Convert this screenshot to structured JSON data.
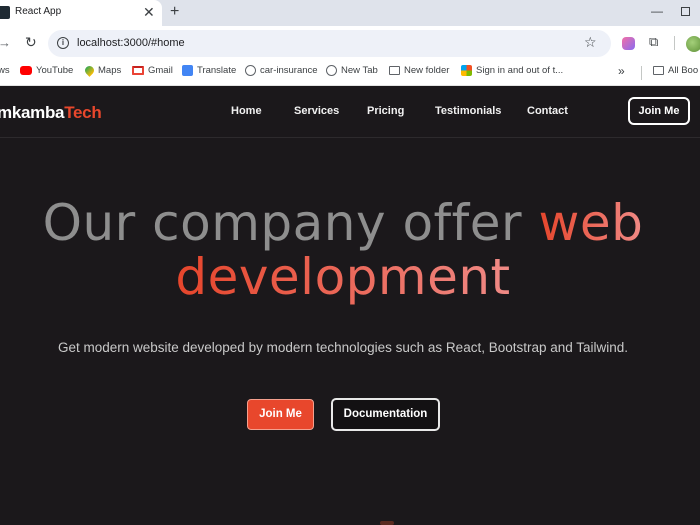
{
  "browser": {
    "tab_title": "React App",
    "tab_close": "✕",
    "new_tab": "+",
    "window_min": "—",
    "url": "localhost:3000/#home",
    "bookmarks": [
      "ws",
      "YouTube",
      "Maps",
      "Gmail",
      "Translate",
      "car-insurance",
      "New Tab",
      "New folder",
      "Sign in and out of t...",
      "All Boo"
    ],
    "bookmarks_more": "»"
  },
  "site": {
    "logo_part1": "mkamba",
    "logo_part2": "Tech",
    "nav": [
      "Home",
      "Services",
      "Pricing",
      "Testimonials",
      "Contact"
    ],
    "join_button": "Join Me"
  },
  "hero": {
    "title_line1_grey": "Our company offer ",
    "title_line1_accent": "web",
    "title_line2_accent": "development",
    "subtitle": "Get modern website developed by modern technologies such as React, Bootstrap and Tailwind.",
    "primary_button": "Join Me",
    "secondary_button": "Documentation"
  },
  "colors": {
    "accent": "#e8472c",
    "accent_gradient_end": "#f08a86",
    "background": "#1b181b",
    "title_grey": "#8e8e8e"
  }
}
